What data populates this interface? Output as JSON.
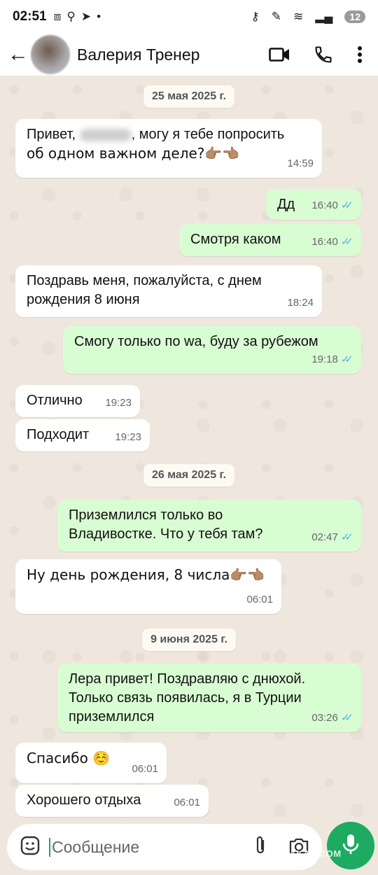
{
  "status_bar": {
    "time": "02:51",
    "notif_count": "12"
  },
  "header": {
    "contact_name": "Валерия Тренер"
  },
  "chat": {
    "dates": [
      "25 мая 2025 г.",
      "26 мая 2025 г.",
      "9 июня 2025 г."
    ],
    "messages": [
      {
        "dir": "in",
        "text_a": "Привет, ",
        "text_b": ", могу я тебе попросить",
        "text_c": "об одном важном деле?👉🏽👈🏽",
        "time": "14:59"
      },
      {
        "dir": "out",
        "text": "Дд",
        "time": "16:40"
      },
      {
        "dir": "out",
        "text": "Смотря каком",
        "time": "16:40"
      },
      {
        "dir": "in",
        "line1": "Поздравь меня, пожалуйста, с днем",
        "line2": "рождения 8 июня",
        "time": "18:24"
      },
      {
        "dir": "out",
        "text": "Смогу только по wa, буду за рубежом",
        "time": "19:18"
      },
      {
        "dir": "in",
        "text": "Отлично",
        "time": "19:23"
      },
      {
        "dir": "in",
        "text": "Подходит",
        "time": "19:23"
      },
      {
        "dir": "out",
        "line1": "Приземлился только во",
        "line2": "Владивостке. Что у тебя там?",
        "time": "02:47"
      },
      {
        "dir": "in",
        "text": "Ну день рождения, 8 числа👉🏽👈🏽",
        "time": "06:01"
      },
      {
        "dir": "out",
        "line1": "Лера привет! Поздравляю с днюхой.",
        "line2": "Только связь появилась, я в Турции",
        "line3": "приземлился",
        "time": "03:26"
      },
      {
        "dir": "in",
        "text": "Спасибо ☺️",
        "time": "06:01"
      },
      {
        "dir": "in",
        "text": "Хорошего отдыха",
        "time": "06:01"
      }
    ]
  },
  "composer": {
    "placeholder": "Сообщение"
  },
  "watermark": "YAPLAKAL.COM",
  "colors": {
    "outgoing": "#d9fdd3",
    "incoming": "#ffffff",
    "accent": "#1daa61",
    "read_ticks": "#4fb6ec"
  },
  "icons": [
    "back-arrow-icon",
    "video-call-icon",
    "phone-icon",
    "more-vert-icon",
    "sticker-icon",
    "attach-icon",
    "camera-icon",
    "mic-icon"
  ]
}
